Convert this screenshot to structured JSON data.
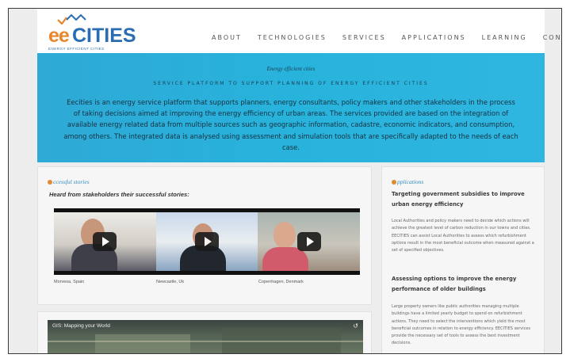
{
  "logo": {
    "ee": "ee",
    "cities": "CITIES",
    "tagline": "ENERGY EFFICIENT CITIES"
  },
  "nav": [
    "ABOUT",
    "TECHNOLOGIES",
    "SERVICES",
    "APPLICATIONS",
    "LEARNING",
    "CONTACT"
  ],
  "banner": {
    "kicker": "Energy efficient cities",
    "subtitle": "SERVICE PLATFORM TO SUPPORT PLANNING OF ENERGY EFFICIENT CITIES",
    "description": "Eecities is an energy service platform that supports planners, energy consultants, policy makers and other stakeholders in the process of taking decisions aimed at improving the energy efficiency of urban areas. The services provided are based on the integration of available energy related data from multiple sources such as geographic information, cadastre, economic indicators, and consumption, among others. The integrated data is analysed using assessment and simulation tools that are specifically adapted to the needs of each case."
  },
  "stories": {
    "title": "ccessful stories",
    "quote": "Heard from stakeholders their successful stories:",
    "videos": [
      {
        "caption": "Morvesa, Spain"
      },
      {
        "caption": "Newcastle, Uk"
      },
      {
        "caption": "Copenhagen, Denmark"
      }
    ]
  },
  "applications": {
    "title": "pplications",
    "items": [
      {
        "heading": "Targeting government subsidies to improve urban energy efficiency",
        "body": "Local Authorities and policy makers need to decide which actions will achieve the greatest level of carbon reduction in our towns and cities. EECITIES can assist Local Authorities to assess which refurbishment options result in the most beneficial outcome when measured against a set of specified objectives."
      },
      {
        "heading": "Assessing options to improve the energy performance of older buildings",
        "body": "Large property owners like public authorities managing multiple buildings have a limited yearly budget to spend on refurbishment actions. They need to select the interventions which yield the most beneficial outcomes in relation to energy efficiency. EECITIES services provide the necessary set of tools to assess the best investment decisions."
      }
    ]
  },
  "video_embed": {
    "title": "GIS: Mapping your World",
    "share_icon": "share-icon"
  },
  "colors": {
    "banner": "#27b3dc",
    "accent_orange": "#e8862a",
    "accent_blue": "#2a6db3"
  }
}
